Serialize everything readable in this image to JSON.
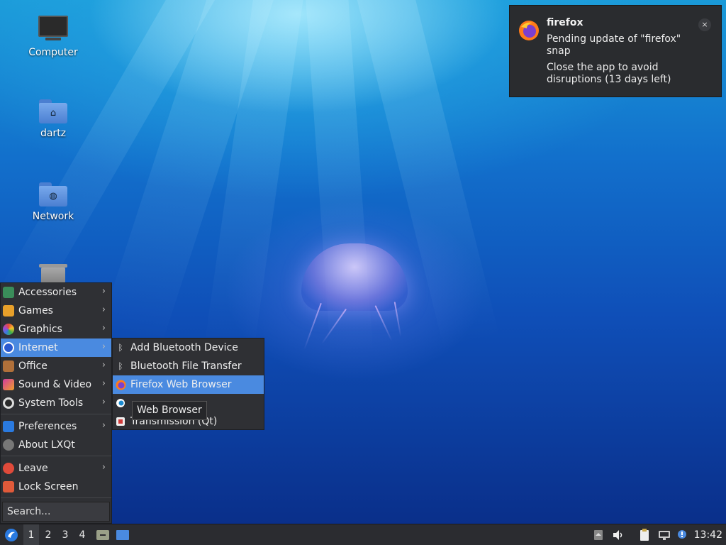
{
  "desktop": {
    "icons": [
      {
        "label": "Computer",
        "icon": "computer-icon"
      },
      {
        "label": "dartz",
        "icon": "home-folder-icon"
      },
      {
        "label": "Network",
        "icon": "network-folder-icon"
      },
      {
        "label": "",
        "icon": "trash-icon"
      }
    ]
  },
  "notification": {
    "app": "firefox",
    "line1": "Pending update of \"firefox\"",
    "line2": "snap",
    "line3": "Close the app to avoid",
    "line4": "disruptions (13 days left)",
    "close_glyph": "×"
  },
  "menu": {
    "items": [
      {
        "label": "Accessories",
        "icon": "accessories-icon",
        "has_submenu": true
      },
      {
        "label": "Games",
        "icon": "games-icon",
        "has_submenu": true
      },
      {
        "label": "Graphics",
        "icon": "graphics-icon",
        "has_submenu": true
      },
      {
        "label": "Internet",
        "icon": "internet-icon",
        "has_submenu": true,
        "active": true
      },
      {
        "label": "Office",
        "icon": "office-icon",
        "has_submenu": true
      },
      {
        "label": "Sound & Video",
        "icon": "sound-video-icon",
        "has_submenu": true
      },
      {
        "label": "System Tools",
        "icon": "system-tools-icon",
        "has_submenu": true
      },
      {
        "label": "Preferences",
        "icon": "preferences-icon",
        "has_submenu": true
      },
      {
        "label": "About LXQt",
        "icon": "info-icon",
        "has_submenu": false
      },
      {
        "label": "Leave",
        "icon": "power-icon",
        "has_submenu": true
      },
      {
        "label": "Lock Screen",
        "icon": "lock-icon",
        "has_submenu": false
      }
    ],
    "search_placeholder": "Search...",
    "arrow": "›"
  },
  "submenu": {
    "items": [
      {
        "label": "Add Bluetooth Device",
        "icon": "bluetooth-icon"
      },
      {
        "label": "Bluetooth File Transfer",
        "icon": "bluetooth-icon"
      },
      {
        "label": "Firefox Web Browser",
        "icon": "firefox-icon",
        "active": true
      },
      {
        "label": "",
        "icon": "browser-icon"
      },
      {
        "label": "Transmission (Qt)",
        "icon": "transmission-icon"
      }
    ],
    "tooltip": "Web Browser"
  },
  "taskbar": {
    "workspaces": [
      "1",
      "2",
      "3",
      "4"
    ],
    "active_workspace": "1",
    "clock": "13:42"
  },
  "colors": {
    "accent": "#4a8ae0",
    "panel": "#2b2c30",
    "menu_bg": "#2f3034"
  }
}
